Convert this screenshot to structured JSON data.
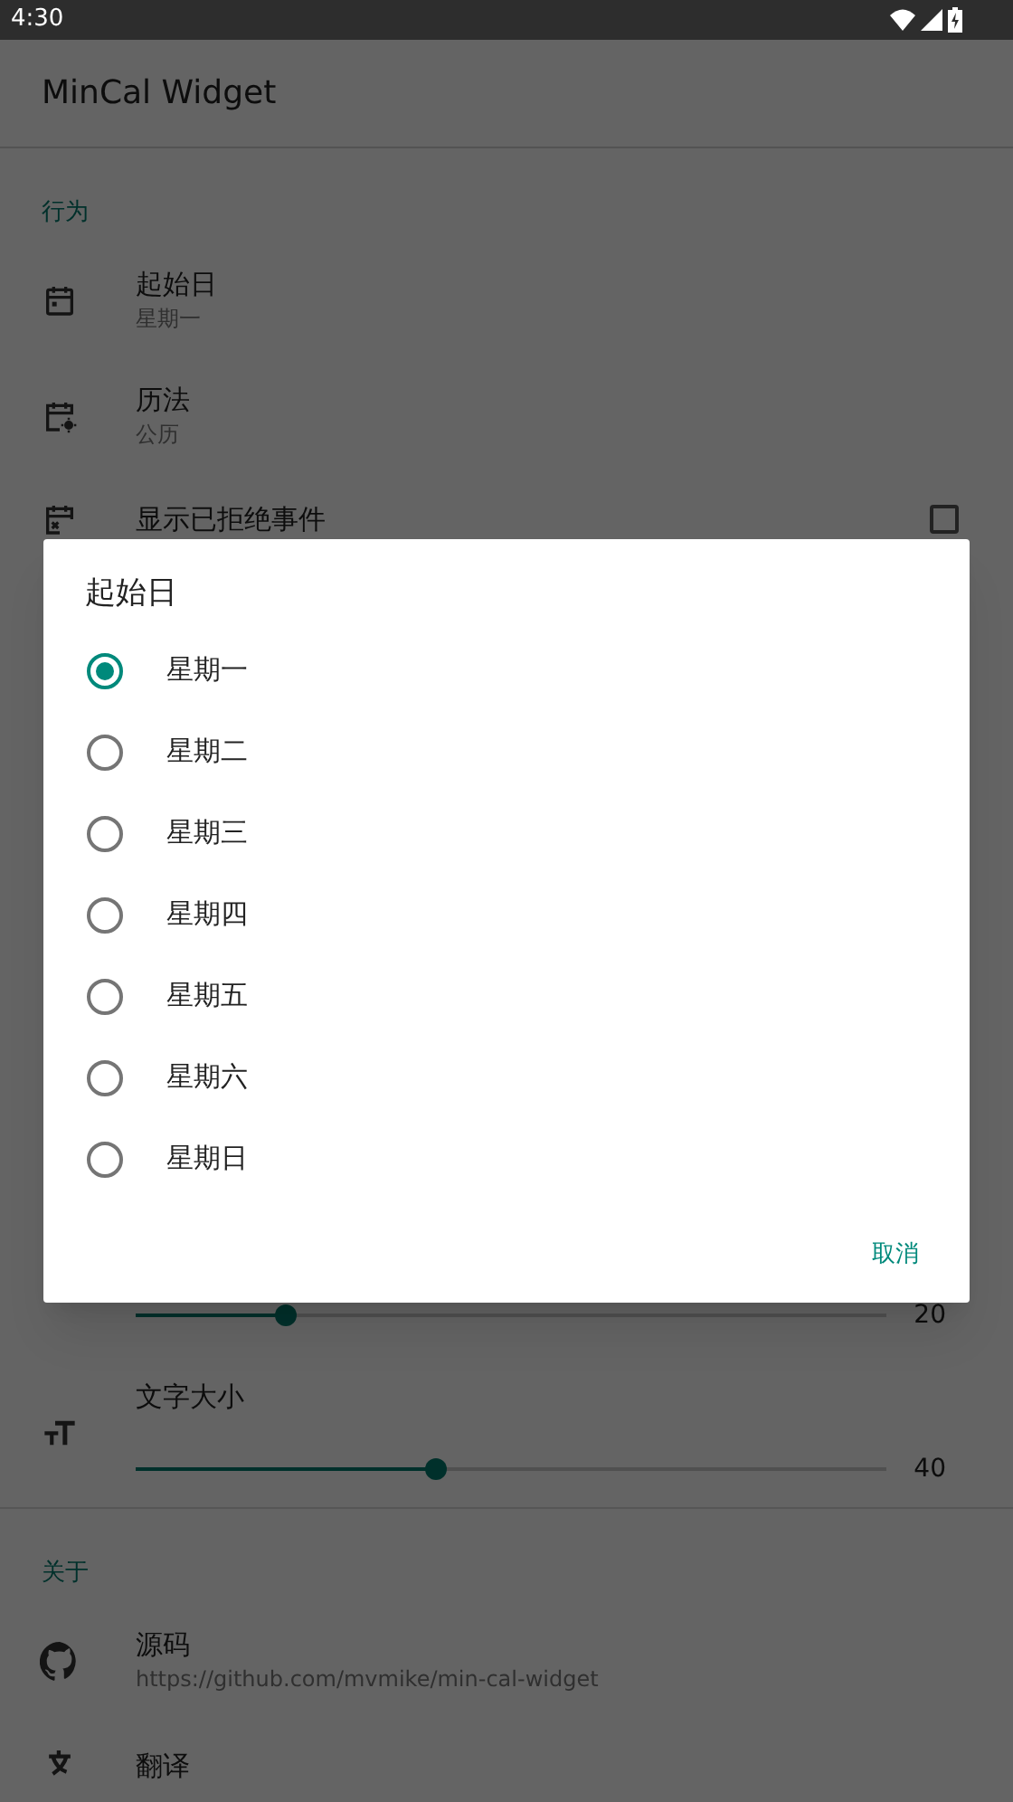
{
  "status_bar": {
    "time": "4:30"
  },
  "app_bar": {
    "title": "MinCal Widget"
  },
  "sections": [
    {
      "kind": "header",
      "text": "行为"
    },
    {
      "kind": "item",
      "title": "起始日",
      "subtitle": "星期一"
    },
    {
      "kind": "item",
      "title": "历法",
      "subtitle": "公历"
    },
    {
      "kind": "checkbox",
      "title": "显示已拒绝事件",
      "checked": false
    },
    {
      "kind": "gap"
    },
    {
      "kind": "slider",
      "value": "20",
      "level": 0.2
    },
    {
      "kind": "slider",
      "title": "文字大小",
      "value": "40",
      "level": 0.4
    },
    {
      "kind": "divider"
    },
    {
      "kind": "header",
      "text": "关于"
    },
    {
      "kind": "item",
      "title": "源码",
      "subtitle": "https://github.com/mvmike/min-cal-widget"
    },
    {
      "kind": "item",
      "title": "翻译"
    }
  ],
  "dialog": {
    "title": "起始日",
    "options": [
      {
        "label": "星期一",
        "selected": true
      },
      {
        "label": "星期二",
        "selected": false
      },
      {
        "label": "星期三",
        "selected": false
      },
      {
        "label": "星期四",
        "selected": false
      },
      {
        "label": "星期五",
        "selected": false
      },
      {
        "label": "星期六",
        "selected": false
      },
      {
        "label": "星期日",
        "selected": false
      }
    ],
    "buttons": [
      "取消"
    ]
  }
}
